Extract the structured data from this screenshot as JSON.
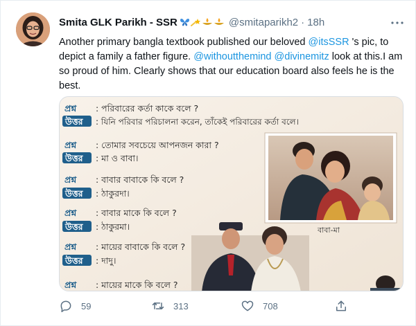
{
  "tweet": {
    "author": {
      "display_name": "Smita GLK Parikh - SSR",
      "name_emojis": [
        "butterfly",
        "shooting-star",
        "diya-lamp",
        "diya-lamp"
      ],
      "handle": "@smitaparikh2",
      "separator": "·",
      "time": "18h"
    },
    "text": {
      "line1_prefix": "Another primary bangla textbook published our beloved ",
      "mention_itsssr": "@itsSSR",
      "line1_suffix": " 's pic, to depict a family a father figure. ",
      "mention_withoutthemind": "@withoutthemind",
      "space": " ",
      "mention_divinemitz": "@divinemitz",
      "rest": " look at this.I am so proud of him. Clearly shows that our education board also feels he is the best."
    },
    "media": {
      "qa": [
        {
          "q_label": "প্রশ্ন",
          "a_label": "উত্তর",
          "question": ": পরিবারের কর্তা কাকে বলে ?",
          "answer": ": যিনি পরিবার পরিচালনা করেন, তাঁকেই পরিবারের কর্তা বলে।"
        },
        {
          "q_label": "প্রশ্ন",
          "a_label": "উত্তর",
          "question": ": তোমার সবচেয়ে আপনজন কারা ?",
          "answer": ": মা ও বাবা।"
        },
        {
          "q_label": "প্রশ্ন",
          "a_label": "উত্তর",
          "question": ": বাবার বাবাকে কি বলে ?",
          "answer": ": ঠাকুরদা।"
        },
        {
          "q_label": "প্রশ্ন",
          "a_label": "উত্তর",
          "question": ": বাবার মাকে কি বলে ?",
          "answer": ": ঠাকুরমা।"
        },
        {
          "q_label": "প্রশ্ন",
          "a_label": "উত্তর",
          "question": ": মায়ের বাবাকে কি বলে ?",
          "answer": ": দাদু।"
        },
        {
          "q_label": "প্রশ্ন",
          "a_label": "",
          "question": ": মায়ের মাকে কি বলে ?",
          "answer": ""
        }
      ],
      "family_photo_caption": "বাবা-মা"
    },
    "actions": {
      "reply_count": "59",
      "retweet_count": "313",
      "like_count": "708"
    },
    "colors": {
      "accent": "#1b95e0",
      "muted": "#5b7083",
      "answer_label_bg": "#1f5f8b",
      "page_bg": "#f6efe6"
    }
  }
}
